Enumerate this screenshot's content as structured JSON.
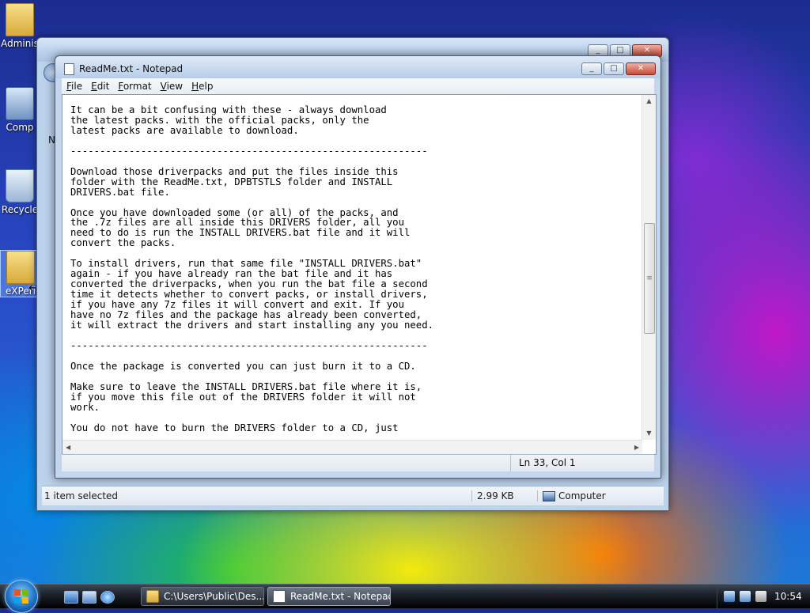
{
  "desktop": {
    "icons": [
      {
        "label": "Adminis"
      },
      {
        "label": "Comp"
      },
      {
        "label": "Recycle"
      },
      {
        "label": "eXPeri"
      }
    ],
    "watermark": "eXPeriance"
  },
  "explorer": {
    "nav_letter": "N",
    "status": {
      "selection": "1 item selected",
      "size": "2.99 KB",
      "location": "Computer"
    }
  },
  "notepad": {
    "title": "ReadMe.txt - Notepad",
    "menu": [
      {
        "label": "File",
        "accel": "F",
        "rest": "ile"
      },
      {
        "label": "Edit",
        "accel": "E",
        "rest": "dit"
      },
      {
        "label": "Format",
        "accel": "F",
        "rest": "ormat"
      },
      {
        "label": "View",
        "accel": "V",
        "rest": "iew"
      },
      {
        "label": "Help",
        "accel": "H",
        "rest": "elp"
      }
    ],
    "text": "It can be a bit confusing with these - always download\nthe latest packs. with the official packs, only the\nlatest packs are available to download.\n\n-------------------------------------------------------------\n\nDownload those driverpacks and put the files inside this\nfolder with the ReadMe.txt, DPBTSTLS folder and INSTALL\nDRIVERS.bat file.\n\nOnce you have downloaded some (or all) of the packs, and\nthe .7z files are all inside this DRIVERS folder, all you\nneed to do is run the INSTALL DRIVERS.bat file and it will\nconvert the packs.\n\nTo install drivers, run that same file \"INSTALL DRIVERS.bat\"\nagain - if you have already ran the bat file and it has\nconverted the driverpacks, when you run the bat file a second\ntime it detects whether to convert packs, or install drivers,\nif you have any 7z files it will convert and exit. If you\nhave no 7z files and the package has already been converted,\nit will extract the drivers and start installing any you need.\n\n-------------------------------------------------------------\n\nOnce the package is converted you can just burn it to a CD.\n\nMake sure to leave the INSTALL DRIVERS.bat file where it is,\nif you move this file out of the DRIVERS folder it will not\nwork.\n\nYou do not have to burn the DRIVERS folder to a CD, just",
    "status_position": "Ln 33, Col 1",
    "vscroll_position": 0.55
  },
  "taskbar": {
    "tasks": [
      {
        "label": "C:\\Users\\Public\\Des..."
      },
      {
        "label": "ReadMe.txt - Notepad"
      }
    ],
    "clock": "10:54"
  },
  "colors": {
    "taskbar": "#1a1f27",
    "window_frame": "#c3d6ee",
    "close_button": "#c94c35"
  }
}
